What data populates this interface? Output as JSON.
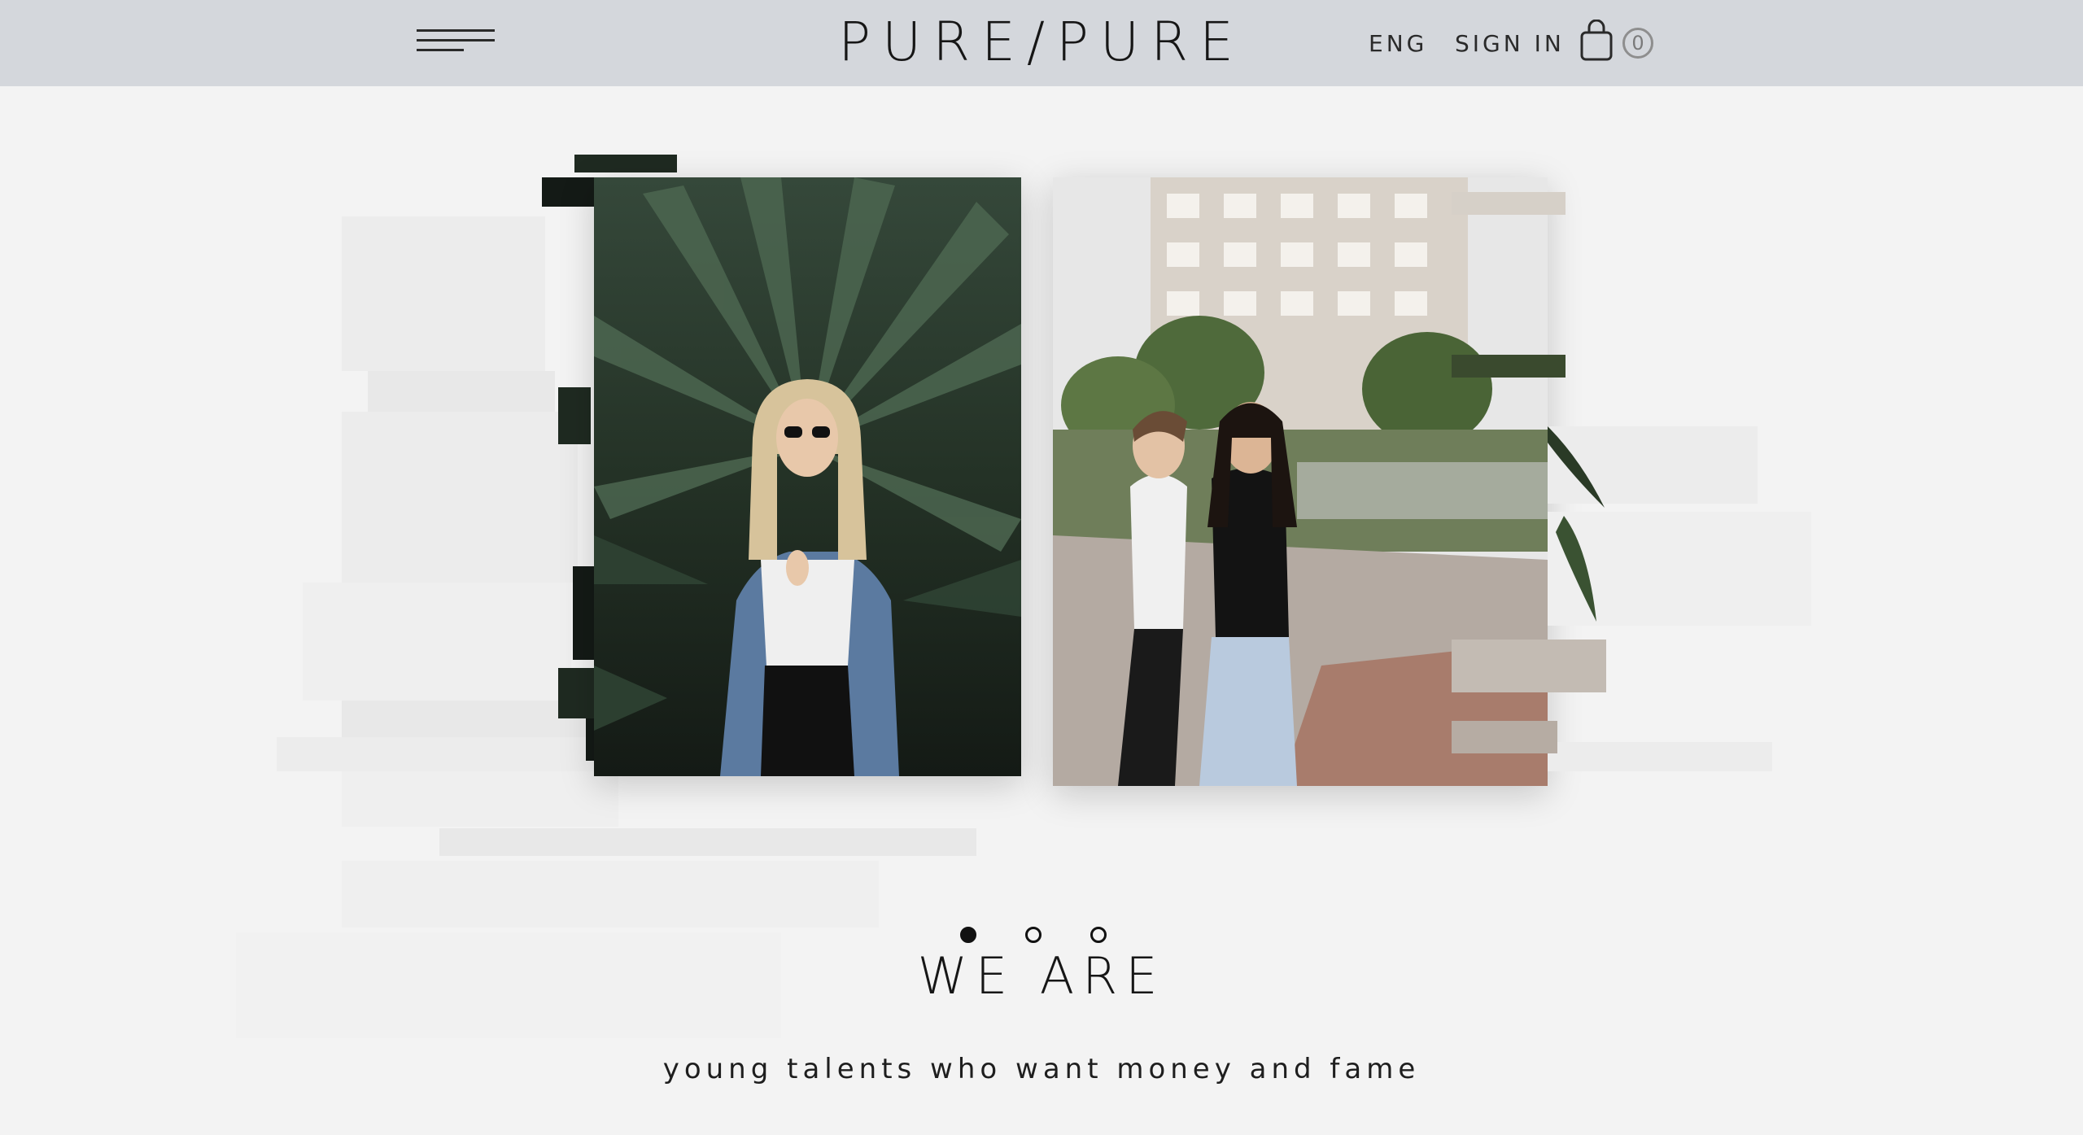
{
  "header": {
    "logo": "PURE/PURE",
    "language": "ENG",
    "sign_in": "SIGN IN",
    "cart_count": "0"
  },
  "slider": {
    "slides_total": 3,
    "active_slide": 1,
    "photos": [
      {
        "name": "woman in denim jacket among palm leaves"
      },
      {
        "name": "two women on city street"
      }
    ]
  },
  "intro": {
    "title": "WE ARE",
    "subtitle": "young talents who want money and fame"
  }
}
